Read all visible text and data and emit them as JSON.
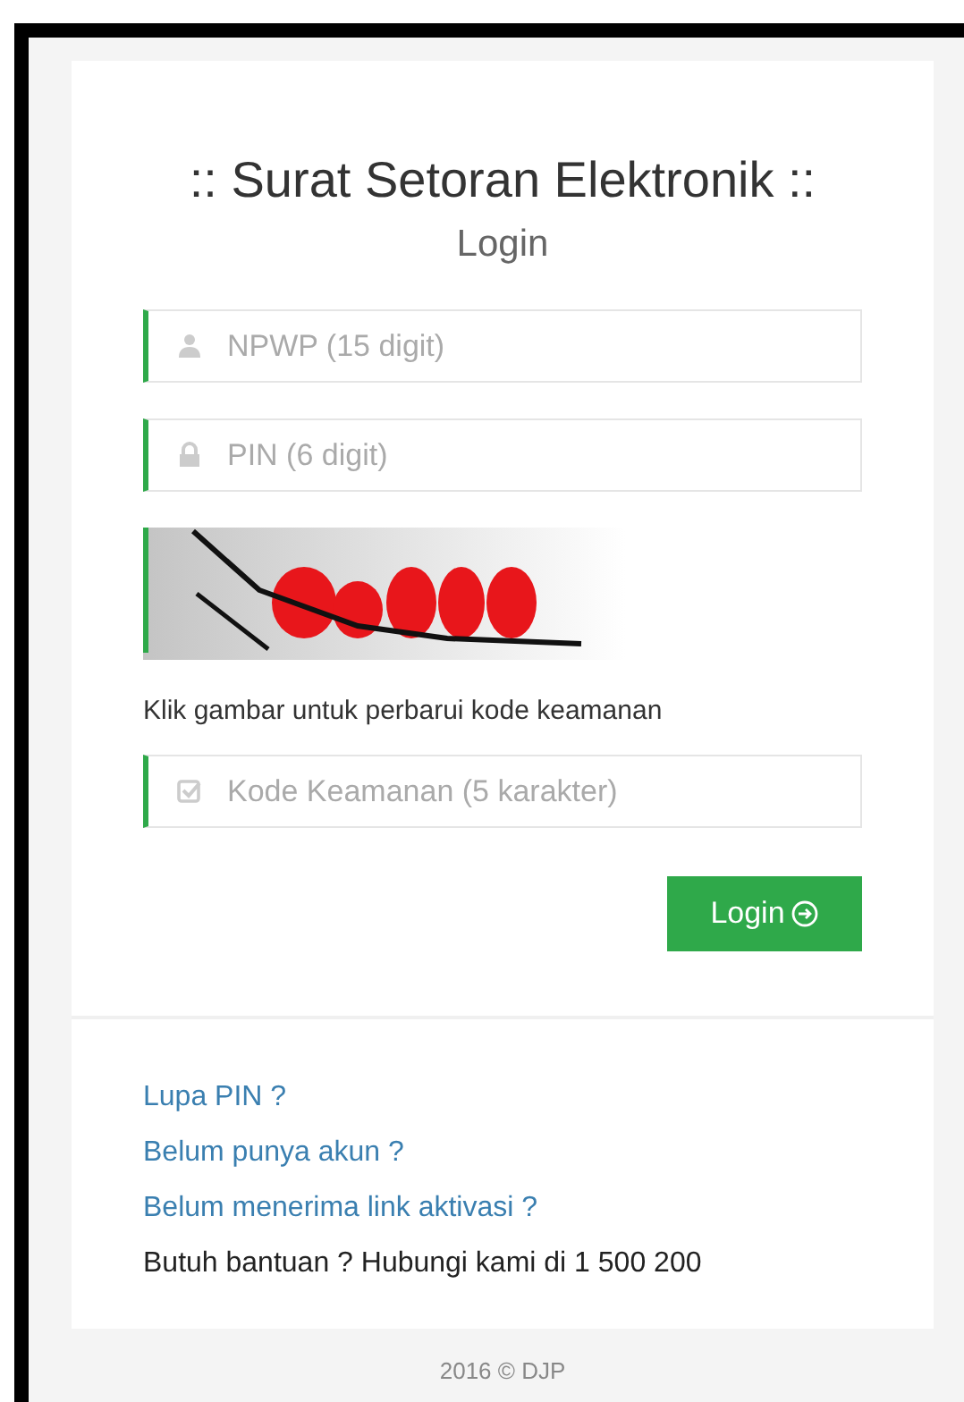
{
  "title": ":: Surat Setoran Elektronik ::",
  "subtitle": "Login",
  "fields": [
    {
      "kind": "user",
      "placeholder": "NPWP (15 digit)"
    },
    {
      "kind": "lock",
      "placeholder": "PIN (6 digit)"
    }
  ],
  "captcha_hint": "Klik gambar untuk perbarui kode keamanan",
  "security_field": {
    "kind": "check",
    "placeholder": "Kode Keamanan (5 karakter)"
  },
  "login_button": "Login",
  "links": [
    {
      "kind": "link",
      "text": "Lupa PIN ?"
    },
    {
      "kind": "link",
      "text": "Belum punya akun ?"
    },
    {
      "kind": "link",
      "text": "Belum menerima link aktivasi ?"
    },
    {
      "kind": "text",
      "text": "Butuh bantuan ? Hubungi kami di 1 500 200"
    }
  ],
  "footer": "2016 © DJP"
}
